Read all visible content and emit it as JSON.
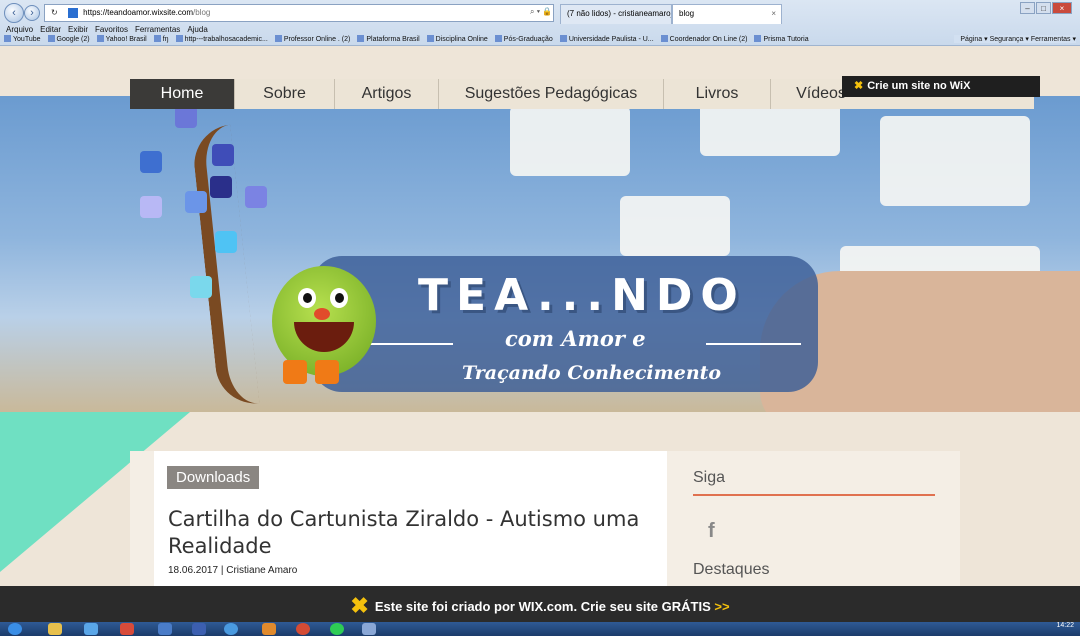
{
  "browser": {
    "address": {
      "host": "https://teandoamor.wixsite.com",
      "path": "/blog"
    },
    "address_tools": "⌕ ▾ 🔒",
    "tabs": [
      {
        "label": "(7 não lidos) - cristianeamaro_..."
      },
      {
        "label": "blog",
        "close": "×"
      }
    ],
    "menu": [
      "Arquivo",
      "Editar",
      "Exibir",
      "Favoritos",
      "Ferramentas",
      "Ajuda"
    ],
    "favorites": [
      "YouTube",
      "Google (2)",
      "Yahoo! Brasil",
      "fŋ",
      "http---trabalhosacademic...",
      "Professor Online . (2)",
      "Plataforma Brasil",
      "Disciplina Online",
      "Pós-Graduação",
      "Universidade Paulista - U...",
      "Coordenador On Line (2)",
      "Prisma Tutoria"
    ],
    "commands": [
      "Página ▾",
      "Segurança ▾",
      "Ferramentas ▾"
    ]
  },
  "site": {
    "nav": [
      "Home",
      "Sobre",
      "Artigos",
      "Sugestões Pedagógicas",
      "Livros",
      "Vídeos"
    ],
    "wix_badge": "Crie um site no WiX",
    "banner": {
      "title": "TEA...NDO",
      "sub1": "com Amor e",
      "sub2": "Traçando Conhecimento"
    },
    "post": {
      "category": "Downloads",
      "title": "Cartilha do Cartunista Ziraldo - Autismo uma Realidade",
      "date": "18.06.2017",
      "separator": "|",
      "author": "Cristiane Amaro"
    },
    "sidebar": {
      "follow": "Siga",
      "facebook_glyph": "f",
      "featured": "Destaques"
    },
    "footer": {
      "text": "Este site foi criado por WIX.com. Crie seu site GRÁTIS",
      "cta": ">>"
    }
  },
  "taskbar": {
    "time": "14:22"
  }
}
